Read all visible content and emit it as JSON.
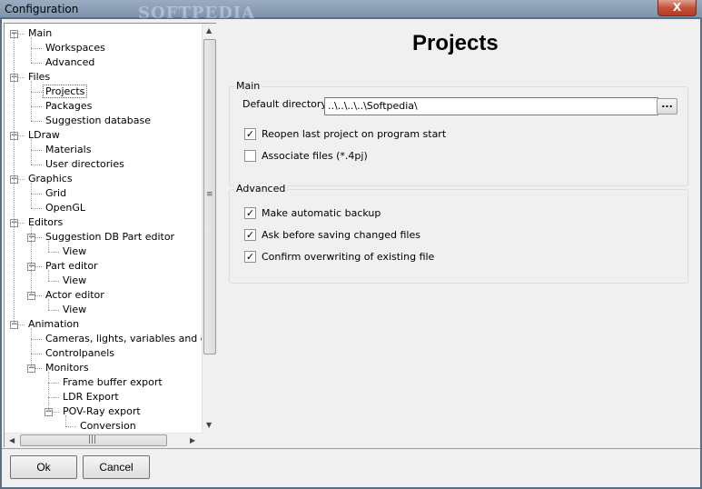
{
  "window": {
    "title": "Configuration",
    "close_glyph": "X",
    "watermark": "SOFTPEDIA",
    "watermark_url": "www.softpedia.com"
  },
  "tree": {
    "items": [
      {
        "label": "Main",
        "indent": 0,
        "expander": "−"
      },
      {
        "label": "Workspaces",
        "indent": 1
      },
      {
        "label": "Advanced",
        "indent": 1
      },
      {
        "label": "Files",
        "indent": 0,
        "expander": "−"
      },
      {
        "label": "Projects",
        "indent": 1,
        "selected": true
      },
      {
        "label": "Packages",
        "indent": 1
      },
      {
        "label": "Suggestion database",
        "indent": 1
      },
      {
        "label": "LDraw",
        "indent": 0,
        "expander": "−"
      },
      {
        "label": "Materials",
        "indent": 1
      },
      {
        "label": "User directories",
        "indent": 1
      },
      {
        "label": "Graphics",
        "indent": 0,
        "expander": "−"
      },
      {
        "label": "Grid",
        "indent": 1
      },
      {
        "label": "OpenGL",
        "indent": 1
      },
      {
        "label": "Editors",
        "indent": 0,
        "expander": "−"
      },
      {
        "label": "Suggestion DB Part editor",
        "indent": 1,
        "expander": "−"
      },
      {
        "label": "View",
        "indent": 2
      },
      {
        "label": "Part editor",
        "indent": 1,
        "expander": "−"
      },
      {
        "label": "View",
        "indent": 2
      },
      {
        "label": "Actor editor",
        "indent": 1,
        "expander": "−"
      },
      {
        "label": "View",
        "indent": 2
      },
      {
        "label": "Animation",
        "indent": 0,
        "expander": "−"
      },
      {
        "label": "Cameras, lights, variables and chara",
        "indent": 1
      },
      {
        "label": "Controlpanels",
        "indent": 1
      },
      {
        "label": "Monitors",
        "indent": 1,
        "expander": "−"
      },
      {
        "label": "Frame buffer export",
        "indent": 2
      },
      {
        "label": "LDR Export",
        "indent": 2
      },
      {
        "label": "POV-Ray export",
        "indent": 2,
        "expander": "−"
      },
      {
        "label": "Conversion",
        "indent": 3
      }
    ]
  },
  "scrollbars": {
    "up": "▲",
    "down": "▼",
    "left": "◀",
    "right": "▶",
    "v_grip": "≡",
    "h_grip": "|||"
  },
  "page": {
    "title": "Projects",
    "main_group": {
      "caption": "Main",
      "default_directory_label": "Default directory",
      "default_directory_value": "..\\..\\..\\..\\Softpedia\\",
      "browse_label": "...",
      "reopen_label": "Reopen last project on program start",
      "reopen_checked": true,
      "associate_label": "Associate files (*.4pj)",
      "associate_checked": false
    },
    "advanced_group": {
      "caption": "Advanced",
      "backup_label": "Make automatic backup",
      "backup_checked": true,
      "ask_label": "Ask before saving changed files",
      "ask_checked": true,
      "confirm_label": "Confirm overwriting of existing file",
      "confirm_checked": true
    },
    "check_glyph": "✓"
  },
  "buttons": {
    "ok": "Ok",
    "cancel": "Cancel"
  }
}
